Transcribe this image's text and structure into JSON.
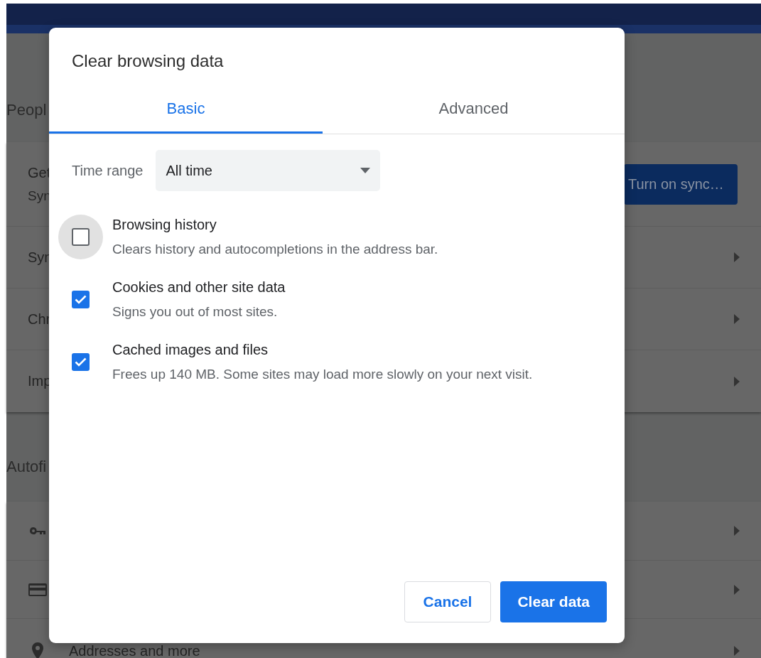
{
  "settings": {
    "sections": [
      {
        "heading": "Peopl",
        "rows": [
          {
            "kind": "sync",
            "title": "Get",
            "subtitle": "Syn",
            "button": "Turn on sync…"
          },
          {
            "kind": "link",
            "title": "Syn"
          },
          {
            "kind": "link",
            "title": "Chr"
          },
          {
            "kind": "link",
            "title": "Imp"
          }
        ]
      },
      {
        "heading": "Autofi",
        "rows": [
          {
            "kind": "key"
          },
          {
            "kind": "card"
          },
          {
            "kind": "pin",
            "title": "Addresses and more"
          }
        ]
      }
    ]
  },
  "dialog": {
    "title": "Clear browsing data",
    "tabs": [
      {
        "label": "Basic",
        "selected": true
      },
      {
        "label": "Advanced",
        "selected": false
      }
    ],
    "time_range": {
      "label": "Time range",
      "value": "All time"
    },
    "items": [
      {
        "title": "Browsing history",
        "description": "Clears history and autocompletions in the address bar.",
        "checked": false,
        "focused": true
      },
      {
        "title": "Cookies and other site data",
        "description": "Signs you out of most sites.",
        "checked": true,
        "focused": false
      },
      {
        "title": "Cached images and files",
        "description": "Frees up 140 MB. Some sites may load more slowly on your next visit.",
        "checked": true,
        "focused": false
      }
    ],
    "buttons": [
      {
        "label": "Cancel",
        "kind": "secondary"
      },
      {
        "label": "Clear data",
        "kind": "primary"
      }
    ]
  }
}
